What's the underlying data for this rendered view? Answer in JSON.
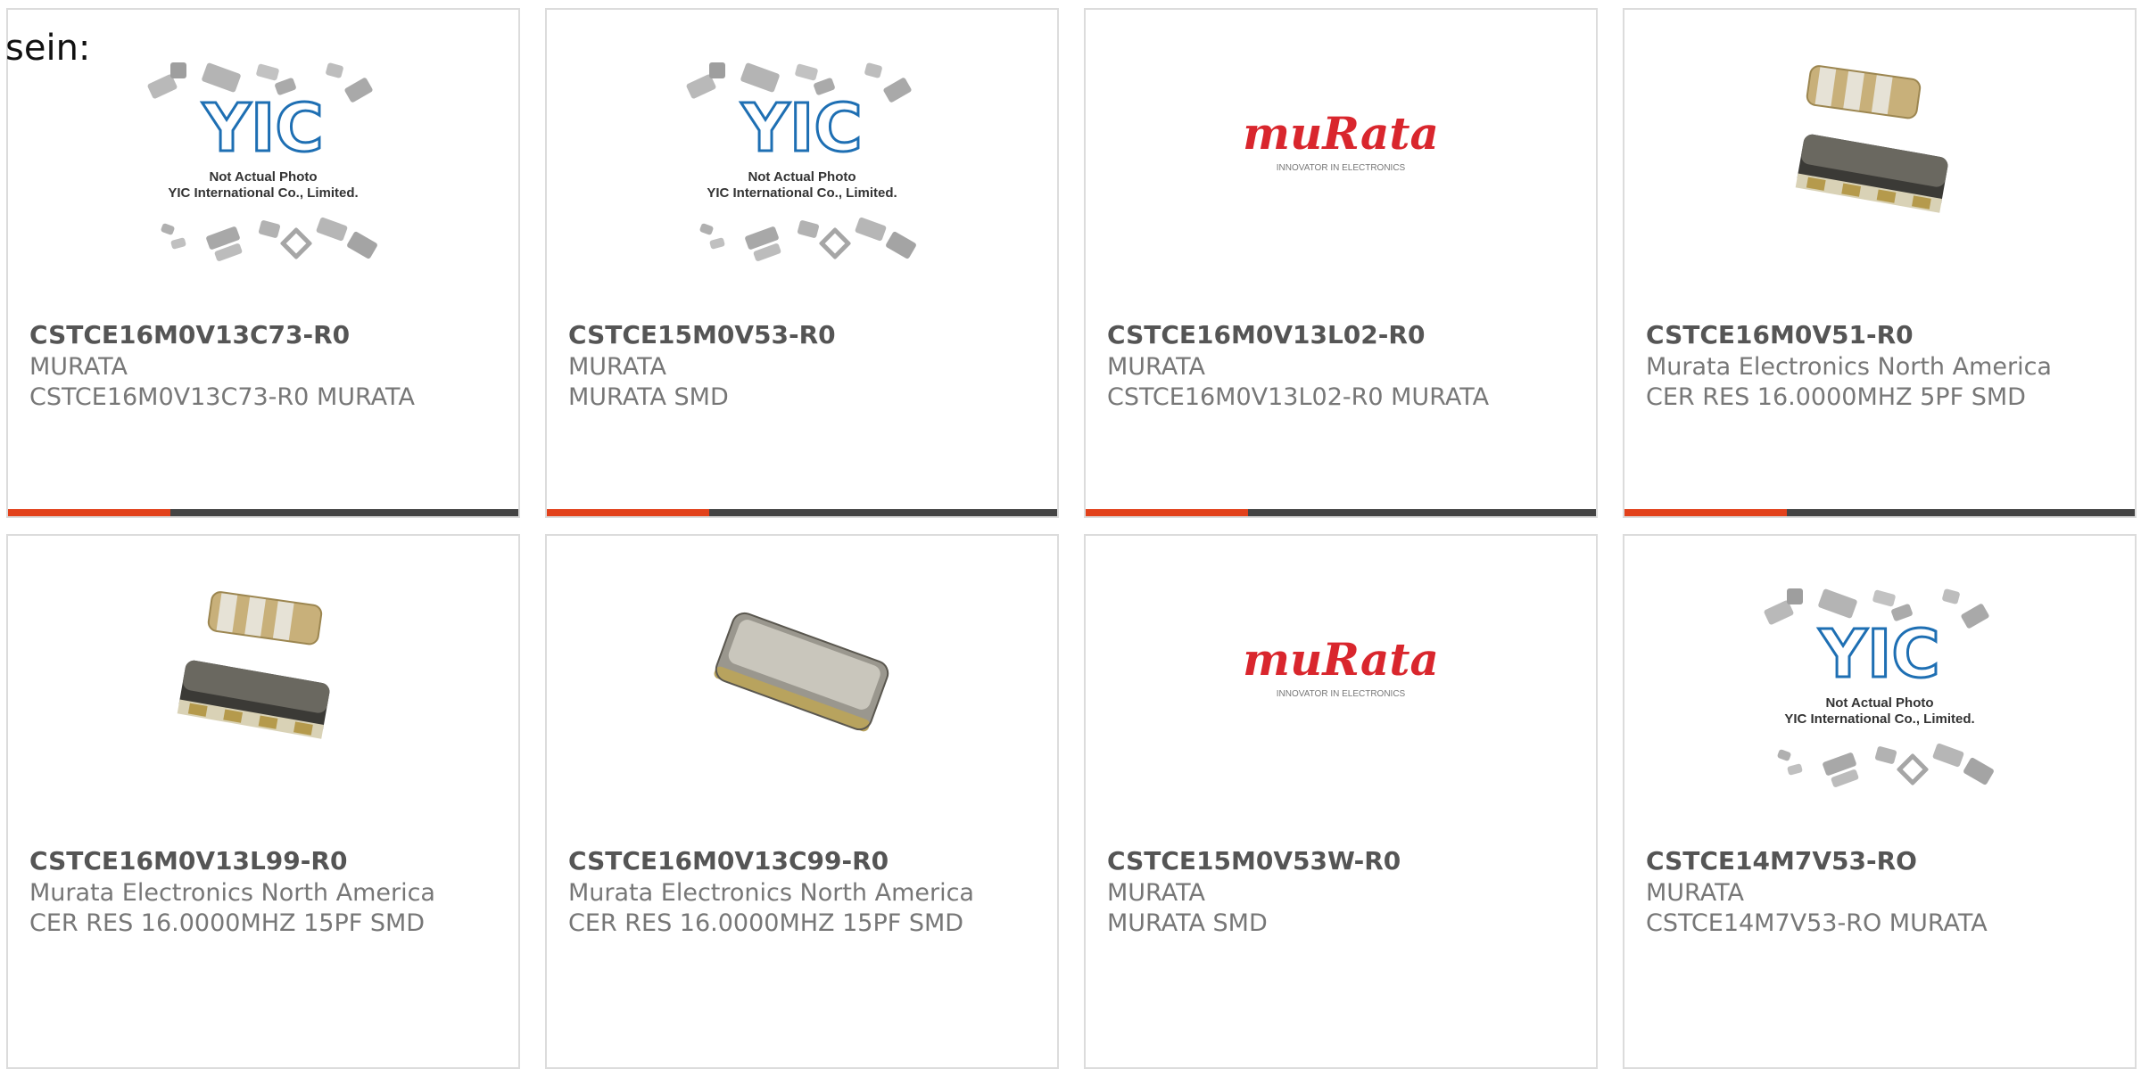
{
  "intro_text": "sein:",
  "colors": {
    "accent": "#e2411b",
    "bar_dark": "#444444",
    "murata_red": "#d9262d",
    "yic_blue": "#1e6fb3",
    "part_text": "#555555",
    "meta_text": "#777777"
  },
  "placeholder_photo": {
    "line1": "Not Actual Photo",
    "line2": "YIC International Co., Limited.",
    "logo": "YIC"
  },
  "murata_logo": {
    "brand": "muRata",
    "tagline": "INNOVATOR IN ELECTRONICS"
  },
  "products": [
    {
      "part": "CSTCE16M0V13C73-R0",
      "manufacturer": "MURATA",
      "description": "CSTCE16M0V13C73-R0 MURATA",
      "image": "yic-placeholder-image"
    },
    {
      "part": "CSTCE15M0V53-R0",
      "manufacturer": "MURATA",
      "description": "MURATA SMD",
      "image": "yic-placeholder-image"
    },
    {
      "part": "CSTCE16M0V13L02-R0",
      "manufacturer": "MURATA",
      "description": "CSTCE16M0V13L02-R0 MURATA",
      "image": "murata-logo-image"
    },
    {
      "part": "CSTCE16M0V51-R0",
      "manufacturer": "Murata Electronics North America",
      "description": "CER RES 16.0000MHZ 5PF SMD",
      "image": "resonator-photo-image"
    },
    {
      "part": "CSTCE16M0V13L99-R0",
      "manufacturer": "Murata Electronics North America",
      "description": "CER RES 16.0000MHZ 15PF SMD",
      "image": "resonator-photo-image"
    },
    {
      "part": "CSTCE16M0V13C99-R0",
      "manufacturer": "Murata Electronics North America",
      "description": "CER RES 16.0000MHZ 15PF SMD",
      "image": "resonator-single-photo-image"
    },
    {
      "part": "CSTCE15M0V53W-R0",
      "manufacturer": "MURATA",
      "description": "MURATA SMD",
      "image": "murata-logo-image"
    },
    {
      "part": "CSTCE14M7V53-RO",
      "manufacturer": "MURATA",
      "description": "CSTCE14M7V53-RO MURATA",
      "image": "yic-placeholder-image"
    }
  ]
}
